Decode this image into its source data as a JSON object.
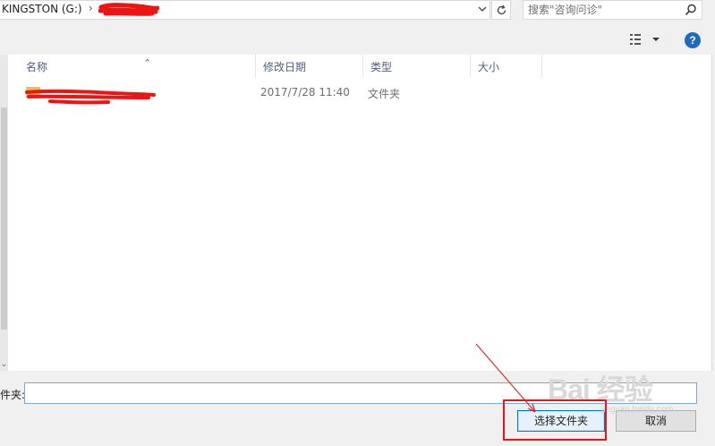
{
  "address": {
    "path_root": "KINGSTON (G:)",
    "separator": "›"
  },
  "search": {
    "placeholder": "搜索\"咨询问诊\""
  },
  "file_list": {
    "columns": [
      "名称",
      "修改日期",
      "类型",
      "大小"
    ],
    "rows": [
      {
        "date": "2017/7/28 11:40",
        "type": "文件夹"
      }
    ]
  },
  "footer": {
    "folder_label": "件夹:",
    "folder_value": "",
    "select_button": "选择文件夹",
    "cancel_button": "取消"
  },
  "toolbar": {
    "help_label": "?"
  },
  "watermark": {
    "main": "Bai 经验",
    "sub": "jingyan.baidu.com"
  },
  "colors": {
    "accent": "#0078d7",
    "annotation": "#e8161b",
    "header_text": "#4d6082"
  }
}
